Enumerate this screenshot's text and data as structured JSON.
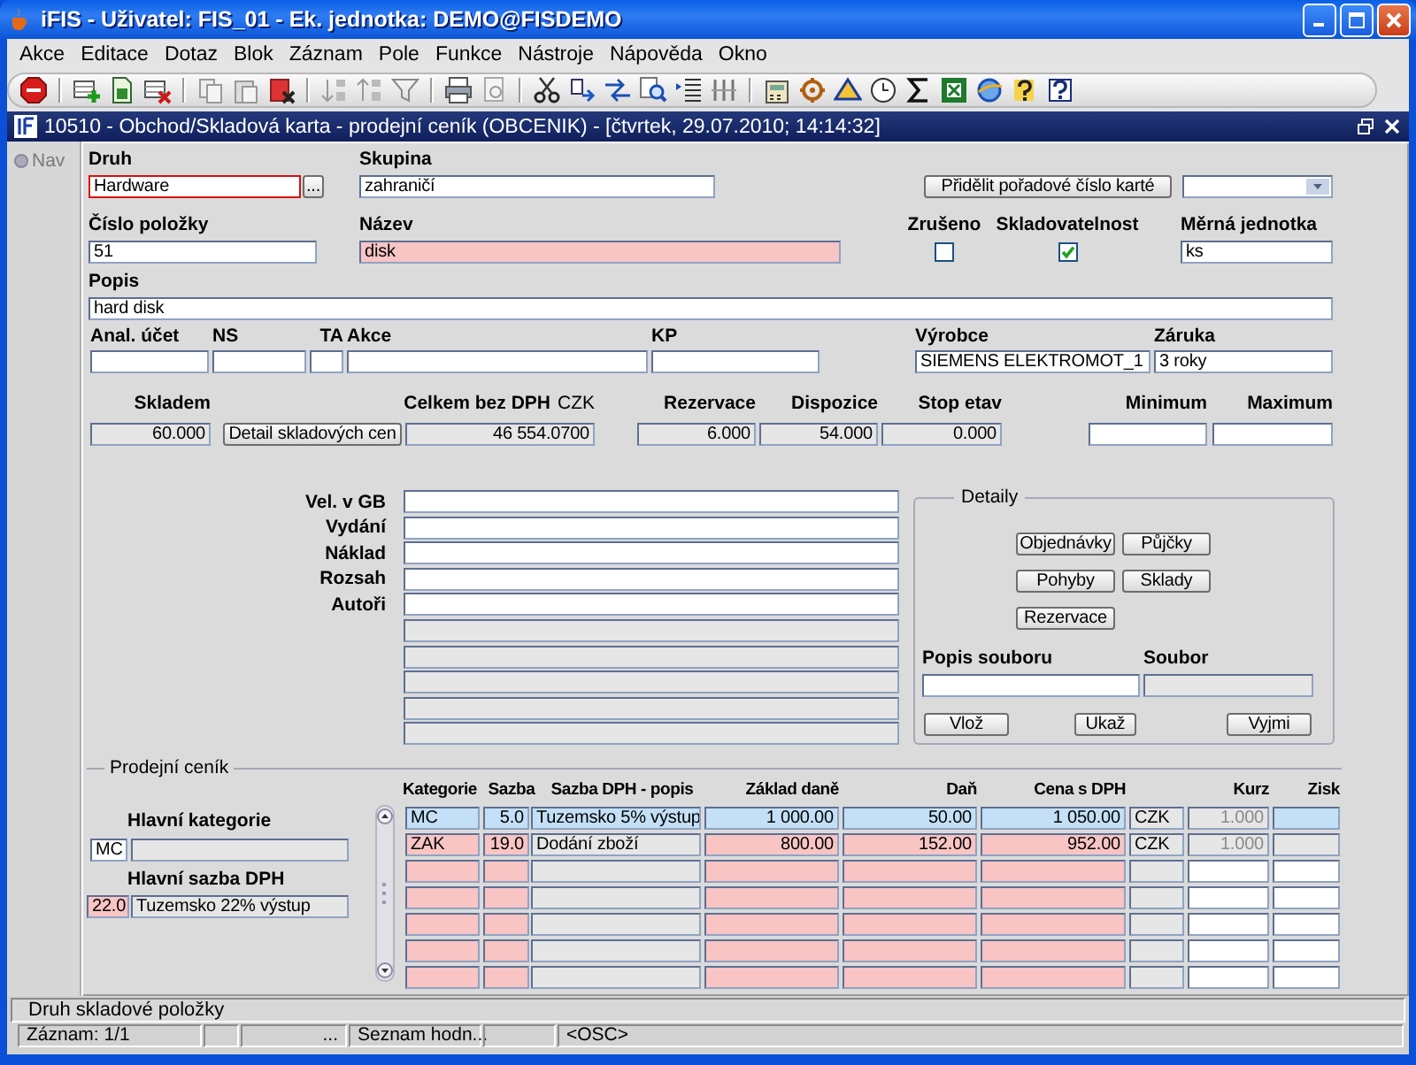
{
  "window": {
    "title": "iFIS - Uživatel: FIS_01 - Ek. jednotka: DEMO@FISDEMO"
  },
  "menu": [
    "Akce",
    "Editace",
    "Dotaz",
    "Blok",
    "Záznam",
    "Pole",
    "Funkce",
    "Nástroje",
    "Nápověda",
    "Okno"
  ],
  "form_window": {
    "title": "10510 - Obchod/Skladová karta - prodejní ceník (OBCENIK) - [čtvrtek, 29.07.2010; 14:14:32]"
  },
  "nav": {
    "label": "Nav"
  },
  "card_rows": [
    {
      "fields": [
        {
          "kind": "text",
          "label": "Druh",
          "value": "Hardware",
          "focused": true
        },
        {
          "kind": "button",
          "text": "..."
        },
        {
          "kind": "text",
          "label": "Skupina",
          "value": "zahraničí",
          "focused": false
        },
        {
          "kind": "button",
          "text": "Přidělit pořadové číslo karté"
        },
        {
          "kind": "select"
        }
      ]
    },
    {
      "fields": [
        {
          "kind": "text",
          "label": "Číslo položky",
          "value": "51",
          "focused": false
        },
        {
          "kind": "required",
          "label": "Název",
          "value": "disk",
          "focused": false
        },
        {
          "kind": "checkbox",
          "label": "Zrušeno",
          "checked": false
        },
        {
          "kind": "checkbox",
          "label": "Skladovatelnost",
          "checked": true
        },
        {
          "kind": "text",
          "label": "Měrná jednotka",
          "value": "ks",
          "focused": false
        }
      ]
    },
    {
      "fields": [
        {
          "kind": "text",
          "label": "Popis",
          "value": "hard disk",
          "focused": false
        }
      ]
    },
    {
      "fields": [
        {
          "kind": "text",
          "label": "Anal. účet",
          "focused": false
        },
        {
          "kind": "text",
          "label": "NS",
          "focused": false
        },
        {
          "kind": "text",
          "label": "TA",
          "focused": false
        },
        {
          "kind": "text",
          "label": "Akce",
          "focused": false
        },
        {
          "kind": "text",
          "label": "KP",
          "focused": false
        },
        {
          "kind": "text",
          "label": "Výrobce",
          "value": "SIEMENS ELEKTROMOT_1",
          "focused": false
        },
        {
          "kind": "text",
          "label": "Záruka",
          "value": "3 roky",
          "focused": false
        }
      ]
    },
    {
      "fields": [
        {
          "kind": "readonly",
          "label": "Skladem",
          "value": "60.000",
          "focused": false
        },
        {
          "kind": "button",
          "text": "Detail skladových cen"
        },
        {
          "kind": "readonly",
          "label": "Celkem bez DPH",
          "unit": "CZK",
          "value": "46 554.0700",
          "focused": false
        },
        {
          "kind": "readonly",
          "label": "Rezervace",
          "value": "6.000",
          "focused": false
        },
        {
          "kind": "readonly",
          "label": "Dispozice",
          "value": "54.000",
          "focused": false
        },
        {
          "kind": "readonly",
          "label": "Stop etav",
          "value": "0.000",
          "focused": false
        },
        {
          "kind": "text",
          "label": "Minimum",
          "focused": false
        },
        {
          "kind": "text",
          "label": "Maximum",
          "focused": false
        }
      ]
    }
  ],
  "extra_fields": [
    {
      "kind": "text",
      "label": "Vel. v GB"
    },
    {
      "kind": "text",
      "label": "Vydání"
    },
    {
      "kind": "text",
      "label": "Náklad"
    },
    {
      "kind": "text",
      "label": "Rozsah"
    },
    {
      "kind": "text",
      "label": "Autoři"
    },
    {
      "kind": "readonly"
    },
    {
      "kind": "readonly"
    },
    {
      "kind": "readonly"
    },
    {
      "kind": "readonly"
    },
    {
      "kind": "readonly"
    }
  ],
  "details": {
    "title": "Detaily",
    "buttons": [
      "Objednávky",
      "Půjčky",
      "Pohyby",
      "Sklady",
      "Rezervace"
    ],
    "file_fields": [
      {
        "kind": "text",
        "label": "Popis souboru"
      },
      {
        "kind": "readonly",
        "label": "Soubor"
      }
    ],
    "file_buttons": [
      "Vlož",
      "Ukaž",
      "Vyjmi"
    ]
  },
  "price_list": {
    "title": "Prodejní ceník",
    "main_category": {
      "label": "Hlavní kategorie",
      "code": "MC"
    },
    "main_vat": {
      "label": "Hlavní sazba DPH",
      "rate": "22.0",
      "name": "Tuzemsko 22% výstup"
    },
    "columns": [
      "Kategorie",
      "Sazba",
      "Sazba DPH - popis",
      "Základ daně",
      "Daň",
      "Cena s DPH",
      "",
      "Kurz",
      "Zisk"
    ],
    "rows": [
      {
        "selected": true,
        "cells": [
          "MC",
          "5.0",
          "Tuzemsko 5% výstup",
          "1 000.00",
          "50.00",
          "1 050.00",
          "CZK",
          "1.000"
        ]
      },
      {
        "selected": false,
        "cells": [
          "ZAK",
          "19.0",
          "Dodání zboží",
          "800.00",
          "152.00",
          "952.00",
          "CZK",
          "1.000"
        ]
      }
    ]
  },
  "status": {
    "hint": "Druh skladové položky",
    "cells": [
      "Záznam: 1/1",
      "...",
      "Seznam hodn...",
      "<OSC>"
    ]
  }
}
